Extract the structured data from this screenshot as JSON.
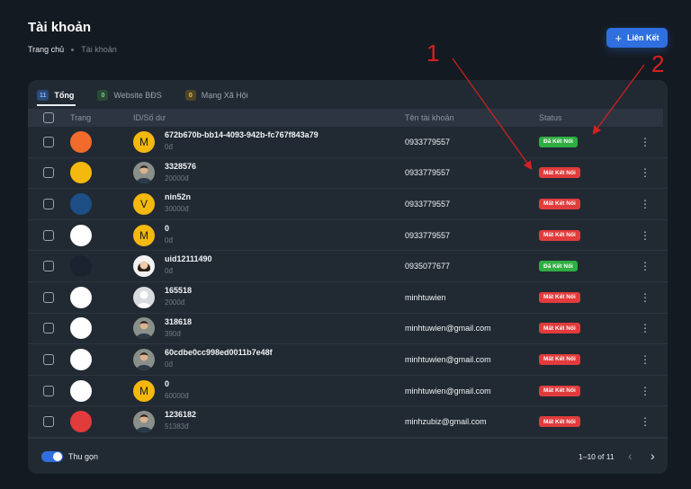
{
  "page": {
    "title": "Tài khoản"
  },
  "breadcrumb": {
    "home": "Trang chủ",
    "current": "Tài khoản"
  },
  "actions": {
    "link_label": "Liên Kết"
  },
  "tabs": [
    {
      "count": "11",
      "label": "Tổng",
      "active": true,
      "badge_color": "blue"
    },
    {
      "count": "0",
      "label": "Website BĐS",
      "active": false,
      "badge_color": "green"
    },
    {
      "count": "0",
      "label": "Mạng Xã Hội",
      "active": false,
      "badge_color": "yellow"
    }
  ],
  "table": {
    "headers": {
      "site": "Trang",
      "id": "ID/Số dư",
      "account": "Tên tài khoản",
      "status": "Status"
    },
    "rows": [
      {
        "logo": "batdongsan",
        "logo_bg": "#f26b2a",
        "avatar": "M",
        "id": "672b670b-bb14-4093-942b-fc767f843a79",
        "balance": "0đ",
        "account": "0933779557",
        "status": "Đã Kết Nối",
        "status_type": "ok"
      },
      {
        "logo": "chotot",
        "logo_bg": "#f5b80f",
        "avatar": "photo",
        "id": "3328576",
        "balance": "20000đ",
        "account": "0933779557",
        "status": "Mất Kết Nối",
        "status_type": "bad"
      },
      {
        "logo": "homedy",
        "logo_bg": "#1d4f86",
        "avatar": "V",
        "id": "nin52n",
        "balance": "30000đ",
        "account": "0933779557",
        "status": "Mất Kết Nối",
        "status_type": "bad"
      },
      {
        "logo": "muaban",
        "logo_bg": "#ffffff",
        "avatar": "M",
        "id": "0",
        "balance": "0đ",
        "account": "0933779557",
        "status": "Mất Kết Nối",
        "status_type": "bad"
      },
      {
        "logo": "mogi",
        "logo_bg": "#1a2230",
        "avatar": "photo-female",
        "id": "uid12111490",
        "balance": "0đ",
        "account": "0935077677",
        "status": "Đã Kết Nối",
        "status_type": "ok"
      },
      {
        "logo": "alonhadat",
        "logo_bg": "#ffffff",
        "avatar": "blank",
        "id": "165518",
        "balance": "2000đ",
        "account": "minhtuwien",
        "status": "Mất Kết Nối",
        "status_type": "bad"
      },
      {
        "logo": "nhadat",
        "logo_bg": "#ffffff",
        "avatar": "photo",
        "id": "318618",
        "balance": "390đ",
        "account": "minhtuwien@gmail.com",
        "status": "Mất Kết Nối",
        "status_type": "bad"
      },
      {
        "logo": "vietnamnay",
        "logo_bg": "#ffffff",
        "avatar": "photo",
        "id": "60cdbe0cc998ed0011b7e48f",
        "balance": "0đ",
        "account": "minhtuwien@gmail.com",
        "status": "Mất Kết Nối",
        "status_type": "bad"
      },
      {
        "logo": "sun",
        "logo_bg": "#ffffff",
        "avatar": "M",
        "id": "0",
        "balance": "60000đ",
        "account": "minhtuwien@gmail.com",
        "status": "Mất Kết Nối",
        "status_type": "bad"
      },
      {
        "logo": "house",
        "logo_bg": "#e23b3b",
        "avatar": "photo",
        "id": "1236182",
        "balance": "51383đ",
        "account": "minhzubiz@gmail.com",
        "status": "Mất Kết Nối",
        "status_type": "bad"
      }
    ]
  },
  "footer": {
    "collapse_label": "Thu gọn",
    "pager": "1–10 of 11"
  },
  "annotations": {
    "arrow1": "1",
    "arrow2": "2"
  },
  "colors": {
    "accent": "#2f6fe0",
    "ok": "#2fae42",
    "bad": "#e23b3b",
    "annotation": "#d62020",
    "avatar_letter": "#f5b80f"
  }
}
